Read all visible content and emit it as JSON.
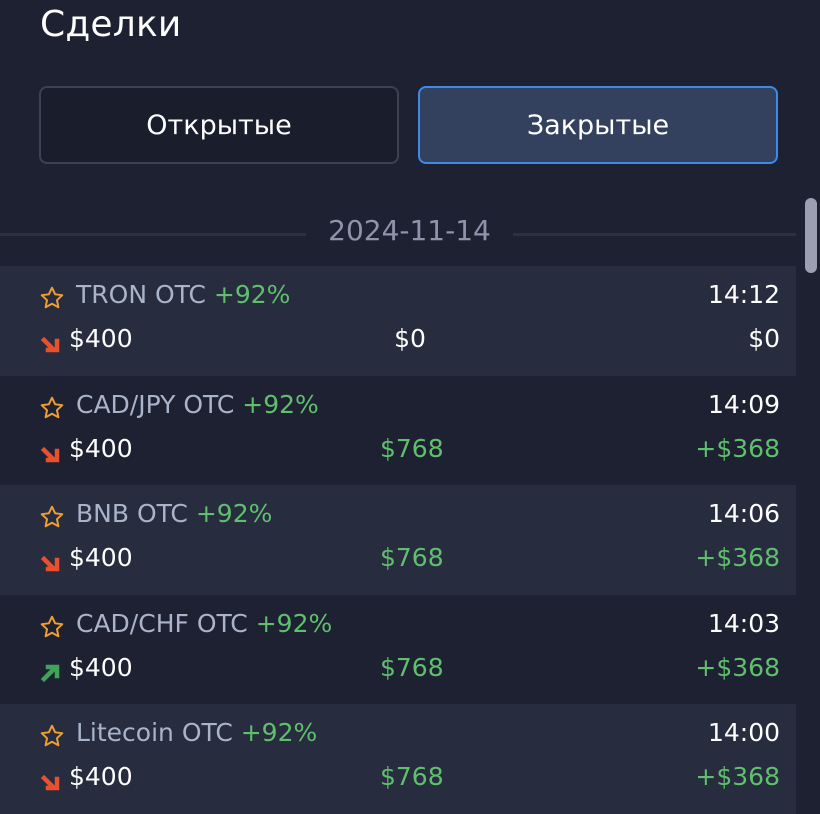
{
  "page": {
    "title": "Сделки"
  },
  "tabs": {
    "open_label": "Открытые",
    "closed_label": "Закрытые"
  },
  "date": "2024-11-14",
  "colors": {
    "accent_blue": "#3d8ae8",
    "win_green": "#5fbf6c",
    "down_red": "#e8502e",
    "up_green": "#3fa45a",
    "star_orange": "#f0a030"
  },
  "trades": [
    {
      "asset": "TRON OTC",
      "percent": "+92%",
      "time": "14:12",
      "direction": "down",
      "amount": "$400",
      "payout": "$0",
      "profit": "$0",
      "win": false
    },
    {
      "asset": "CAD/JPY OTC",
      "percent": "+92%",
      "time": "14:09",
      "direction": "down",
      "amount": "$400",
      "payout": "$768",
      "profit": "+$368",
      "win": true
    },
    {
      "asset": "BNB OTC",
      "percent": "+92%",
      "time": "14:06",
      "direction": "down",
      "amount": "$400",
      "payout": "$768",
      "profit": "+$368",
      "win": true
    },
    {
      "asset": "CAD/CHF OTC",
      "percent": "+92%",
      "time": "14:03",
      "direction": "up",
      "amount": "$400",
      "payout": "$768",
      "profit": "+$368",
      "win": true
    },
    {
      "asset": "Litecoin OTC",
      "percent": "+92%",
      "time": "14:00",
      "direction": "down",
      "amount": "$400",
      "payout": "$768",
      "profit": "+$368",
      "win": true
    }
  ]
}
